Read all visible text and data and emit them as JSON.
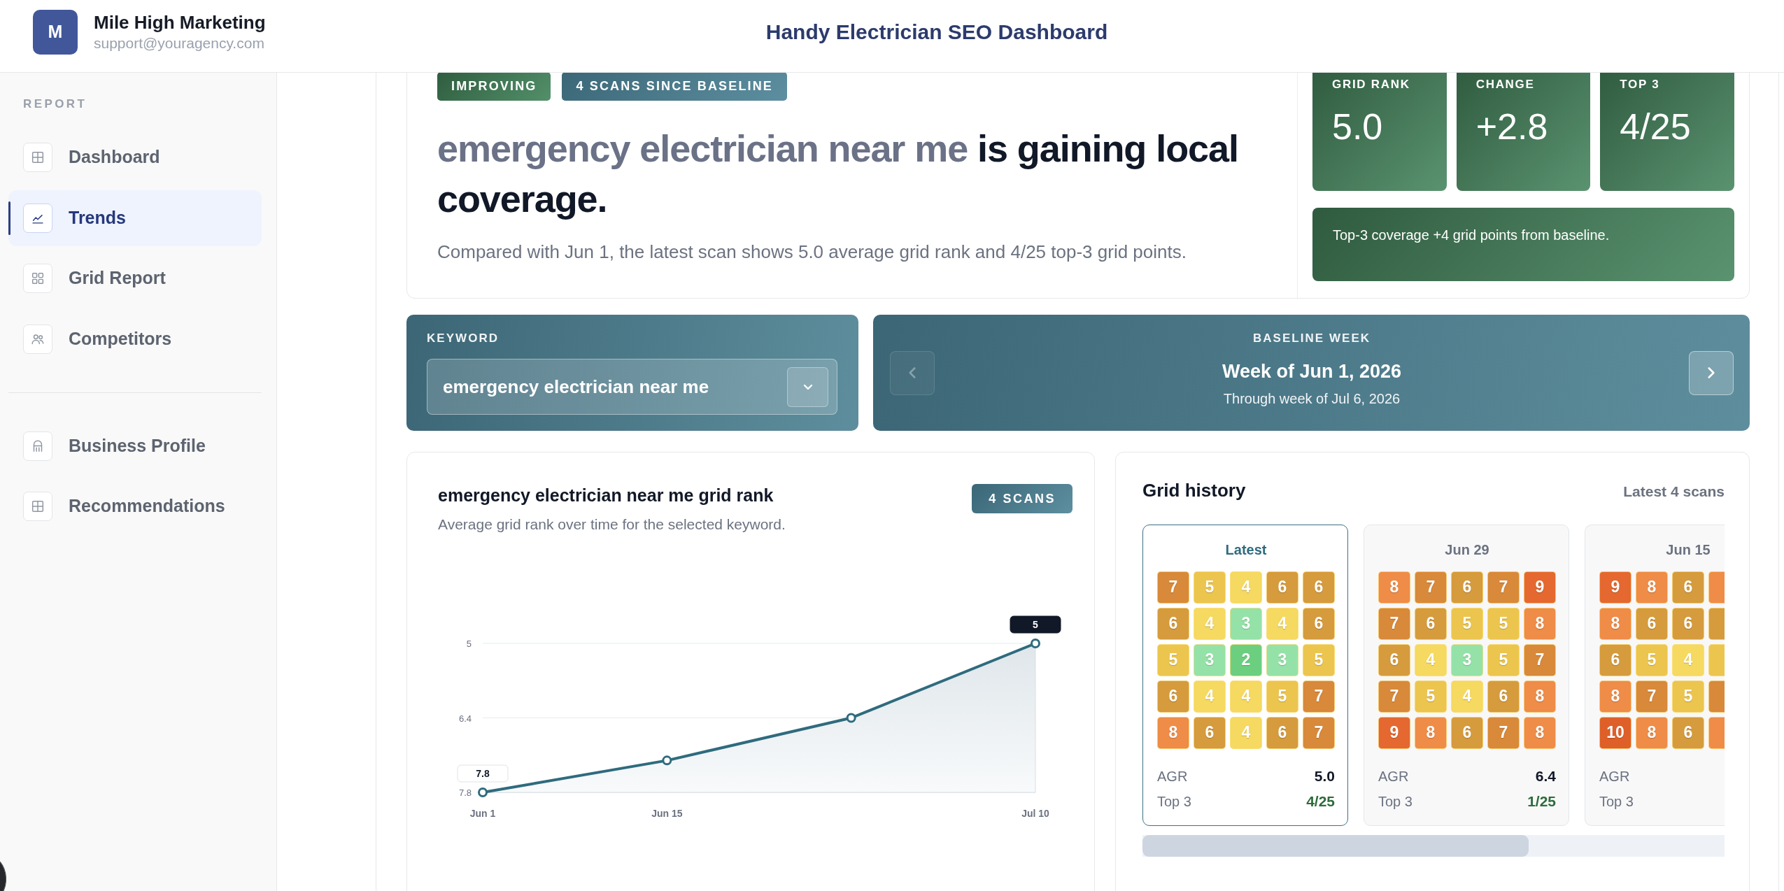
{
  "header": {
    "brand": {
      "initial": "M",
      "name": "Mile High Marketing",
      "email": "support@youragency.com"
    },
    "title": "Handy Electrician SEO Dashboard"
  },
  "sidebar": {
    "section_label": "REPORT",
    "groups": [
      {
        "items": [
          {
            "label": "Dashboard",
            "kind": "grid",
            "selected": false
          },
          {
            "label": "Trends",
            "kind": "chart",
            "selected": true
          },
          {
            "label": "Grid Report",
            "kind": "tiles",
            "selected": false
          },
          {
            "label": "Competitors",
            "kind": "people",
            "selected": false
          }
        ]
      },
      {
        "items": [
          {
            "label": "Business Profile",
            "kind": "building",
            "selected": false
          },
          {
            "label": "Recommendations",
            "kind": "grid",
            "selected": false
          }
        ]
      }
    ]
  },
  "hero": {
    "badges": [
      {
        "text": "IMPROVING",
        "kind": "trend"
      },
      {
        "text": "4 SCANS SINCE BASELINE",
        "kind": "count"
      }
    ],
    "headline": {
      "keyword": "emergency electrician near me",
      "rest": "is gaining local coverage."
    },
    "summary": "Compared with Jun 1, the latest scan shows 5.0 average grid rank and 4/25 top-3 grid points.",
    "stats": [
      {
        "label": "GRID RANK",
        "value": "5.0"
      },
      {
        "label": "CHANGE",
        "value": "+2.8"
      },
      {
        "label": "TOP 3",
        "value": "4/25"
      }
    ],
    "note": "Top-3 coverage +4 grid points from baseline."
  },
  "keyword_picker": {
    "label": "KEYWORD",
    "value": "emergency electrician near me"
  },
  "baseline": {
    "label": "BASELINE WEEK",
    "week": "Week of Jun 1, 2026",
    "through": "Through week of Jul 6, 2026",
    "prev": {
      "disabled": true
    },
    "next": {
      "disabled": false
    }
  },
  "trend_chart": {
    "title": "emergency electrician near me grid rank",
    "subtitle": "Average grid rank over time for the selected keyword.",
    "badge": "4 SCANS",
    "chart_data": {
      "type": "line",
      "categories": [
        "Jun 1",
        "Jun 15",
        null,
        "Jul 10"
      ],
      "values": [
        7.8,
        7.2,
        6.4,
        5
      ],
      "marker": true,
      "ylim": [
        7.8,
        5
      ],
      "yticks": [
        5,
        6.4,
        7.8
      ],
      "value_labels": [
        "7.8",
        null,
        null,
        "5"
      ]
    }
  },
  "grid_history": {
    "title": "Grid history",
    "caption": "Latest 4 scans",
    "panels": [
      {
        "title": "Latest",
        "selected": true,
        "rows": [
          [
            {
              "value": "7",
              "color": "#d8893a"
            },
            {
              "value": "5",
              "color": "#ecc54e"
            },
            {
              "value": "4",
              "color": "#f5d960"
            },
            {
              "value": "6",
              "color": "#d59b3d"
            },
            {
              "value": "6",
              "color": "#d59b3d"
            }
          ],
          [
            {
              "value": "6",
              "color": "#d59b3d"
            },
            {
              "value": "4",
              "color": "#f5d960"
            },
            {
              "value": "3",
              "color": "#95e2a8"
            },
            {
              "value": "4",
              "color": "#f5d960"
            },
            {
              "value": "6",
              "color": "#d59b3d"
            }
          ],
          [
            {
              "value": "5",
              "color": "#ecc54e"
            },
            {
              "value": "3",
              "color": "#95e2a8"
            },
            {
              "value": "2",
              "color": "#6ccf80"
            },
            {
              "value": "3",
              "color": "#95e2a8"
            },
            {
              "value": "5",
              "color": "#ecc54e"
            }
          ],
          [
            {
              "value": "6",
              "color": "#d59b3d"
            },
            {
              "value": "4",
              "color": "#f5d960"
            },
            {
              "value": "4",
              "color": "#f5d960"
            },
            {
              "value": "5",
              "color": "#ecc54e"
            },
            {
              "value": "7",
              "color": "#d8893a"
            }
          ],
          [
            {
              "value": "8",
              "color": "#ee8c48"
            },
            {
              "value": "6",
              "color": "#d59b3d"
            },
            {
              "value": "4",
              "color": "#f5d960"
            },
            {
              "value": "6",
              "color": "#d59b3d"
            },
            {
              "value": "7",
              "color": "#d8893a"
            }
          ]
        ],
        "stats": [
          {
            "label": "AGR",
            "value": "5.0",
            "kind": "plain"
          },
          {
            "label": "Top 3",
            "value": "4/25",
            "kind": "good"
          }
        ]
      },
      {
        "title": "Jun 29",
        "selected": false,
        "rows": [
          [
            {
              "value": "8",
              "color": "#ee8c48"
            },
            {
              "value": "7",
              "color": "#d8893a"
            },
            {
              "value": "6",
              "color": "#d59b3d"
            },
            {
              "value": "7",
              "color": "#d8893a"
            },
            {
              "value": "9",
              "color": "#e4682f"
            }
          ],
          [
            {
              "value": "7",
              "color": "#d8893a"
            },
            {
              "value": "6",
              "color": "#d59b3d"
            },
            {
              "value": "5",
              "color": "#ecc54e"
            },
            {
              "value": "5",
              "color": "#ecc54e"
            },
            {
              "value": "8",
              "color": "#ee8c48"
            }
          ],
          [
            {
              "value": "6",
              "color": "#d59b3d"
            },
            {
              "value": "4",
              "color": "#f5d960"
            },
            {
              "value": "3",
              "color": "#95e2a8"
            },
            {
              "value": "5",
              "color": "#ecc54e"
            },
            {
              "value": "7",
              "color": "#d8893a"
            }
          ],
          [
            {
              "value": "7",
              "color": "#d8893a"
            },
            {
              "value": "5",
              "color": "#ecc54e"
            },
            {
              "value": "4",
              "color": "#f5d960"
            },
            {
              "value": "6",
              "color": "#d59b3d"
            },
            {
              "value": "8",
              "color": "#ee8c48"
            }
          ],
          [
            {
              "value": "9",
              "color": "#e4682f"
            },
            {
              "value": "8",
              "color": "#ee8c48"
            },
            {
              "value": "6",
              "color": "#d59b3d"
            },
            {
              "value": "7",
              "color": "#d8893a"
            },
            {
              "value": "8",
              "color": "#ee8c48"
            }
          ]
        ],
        "stats": [
          {
            "label": "AGR",
            "value": "6.4",
            "kind": "plain"
          },
          {
            "label": "Top 3",
            "value": "1/25",
            "kind": "good"
          }
        ]
      },
      {
        "title": "Jun 15",
        "selected": false,
        "rows": [
          [
            {
              "value": "9",
              "color": "#e4682f"
            },
            {
              "value": "8",
              "color": "#ee8c48"
            },
            {
              "value": "6",
              "color": "#d59b3d"
            },
            {
              "color": "#ee8c48"
            }
          ],
          [
            {
              "value": "8",
              "color": "#ee8c48"
            },
            {
              "value": "6",
              "color": "#d59b3d"
            },
            {
              "value": "6",
              "color": "#d59b3d"
            },
            {
              "color": "#d59b3d"
            }
          ],
          [
            {
              "value": "6",
              "color": "#d59b3d"
            },
            {
              "value": "5",
              "color": "#ecc54e"
            },
            {
              "value": "4",
              "color": "#f5d960"
            },
            {
              "color": "#ecc54e"
            }
          ],
          [
            {
              "value": "8",
              "color": "#ee8c48"
            },
            {
              "value": "7",
              "color": "#d8893a"
            },
            {
              "value": "5",
              "color": "#ecc54e"
            },
            {
              "color": "#d8893a"
            }
          ],
          [
            {
              "value": "10",
              "color": "#df5f28"
            },
            {
              "value": "8",
              "color": "#ee8c48"
            },
            {
              "value": "6",
              "color": "#d59b3d"
            },
            {
              "color": "#ee8c48"
            }
          ]
        ],
        "stats": [
          {
            "label": "AGR"
          },
          {
            "label": "Top 3"
          }
        ]
      }
    ]
  }
}
